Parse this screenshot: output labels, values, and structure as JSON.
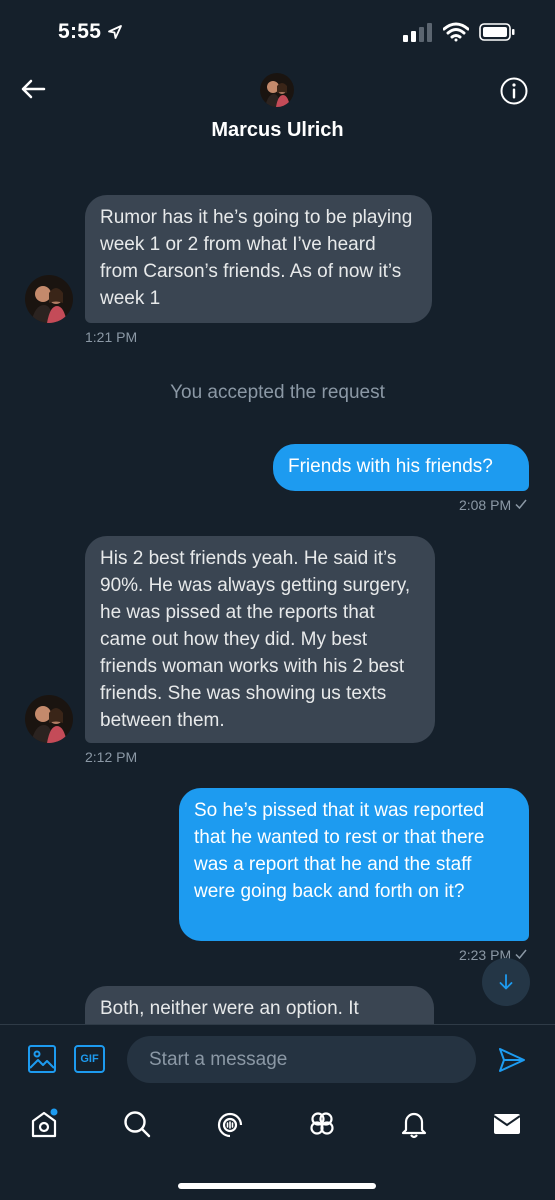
{
  "status_bar": {
    "time": "5:55"
  },
  "header": {
    "name": "Marcus Ulrich"
  },
  "messages": [
    {
      "text": "Rumor has it he’s going to be playing week 1 or 2 from what I’ve heard from Carson’s friends.  As of now it’s week 1",
      "time": "1:21 PM"
    },
    {
      "system": "You accepted the request"
    },
    {
      "text": "Friends with his friends?",
      "time": "2:08 PM"
    },
    {
      "text": "His 2 best friends yeah. He said it’s 90%. He was always getting surgery, he was pissed at the reports that came out how they did. My best friends woman works with his 2 best friends. She was showing us texts between them.",
      "time": "2:12 PM"
    },
    {
      "text": "So he’s pissed that it was reported that he wanted to rest or that there was a report that he and the staff were going back and forth on it?",
      "time": "2:23 PM"
    },
    {
      "text": "Both, neither were an option. It"
    }
  ],
  "composer": {
    "placeholder": "Start a message",
    "gif_label": "GIF"
  },
  "colors": {
    "background": "#15202b",
    "incoming_bubble": "#3a4552",
    "outgoing_bubble": "#1d9bf0",
    "accent": "#1d9bf0"
  },
  "icons": [
    "back-arrow-icon",
    "info-icon",
    "image-icon",
    "gif-icon",
    "send-icon",
    "home-icon",
    "search-icon",
    "spaces-icon",
    "communities-icon",
    "bell-icon",
    "mail-icon",
    "arrow-down-icon"
  ]
}
